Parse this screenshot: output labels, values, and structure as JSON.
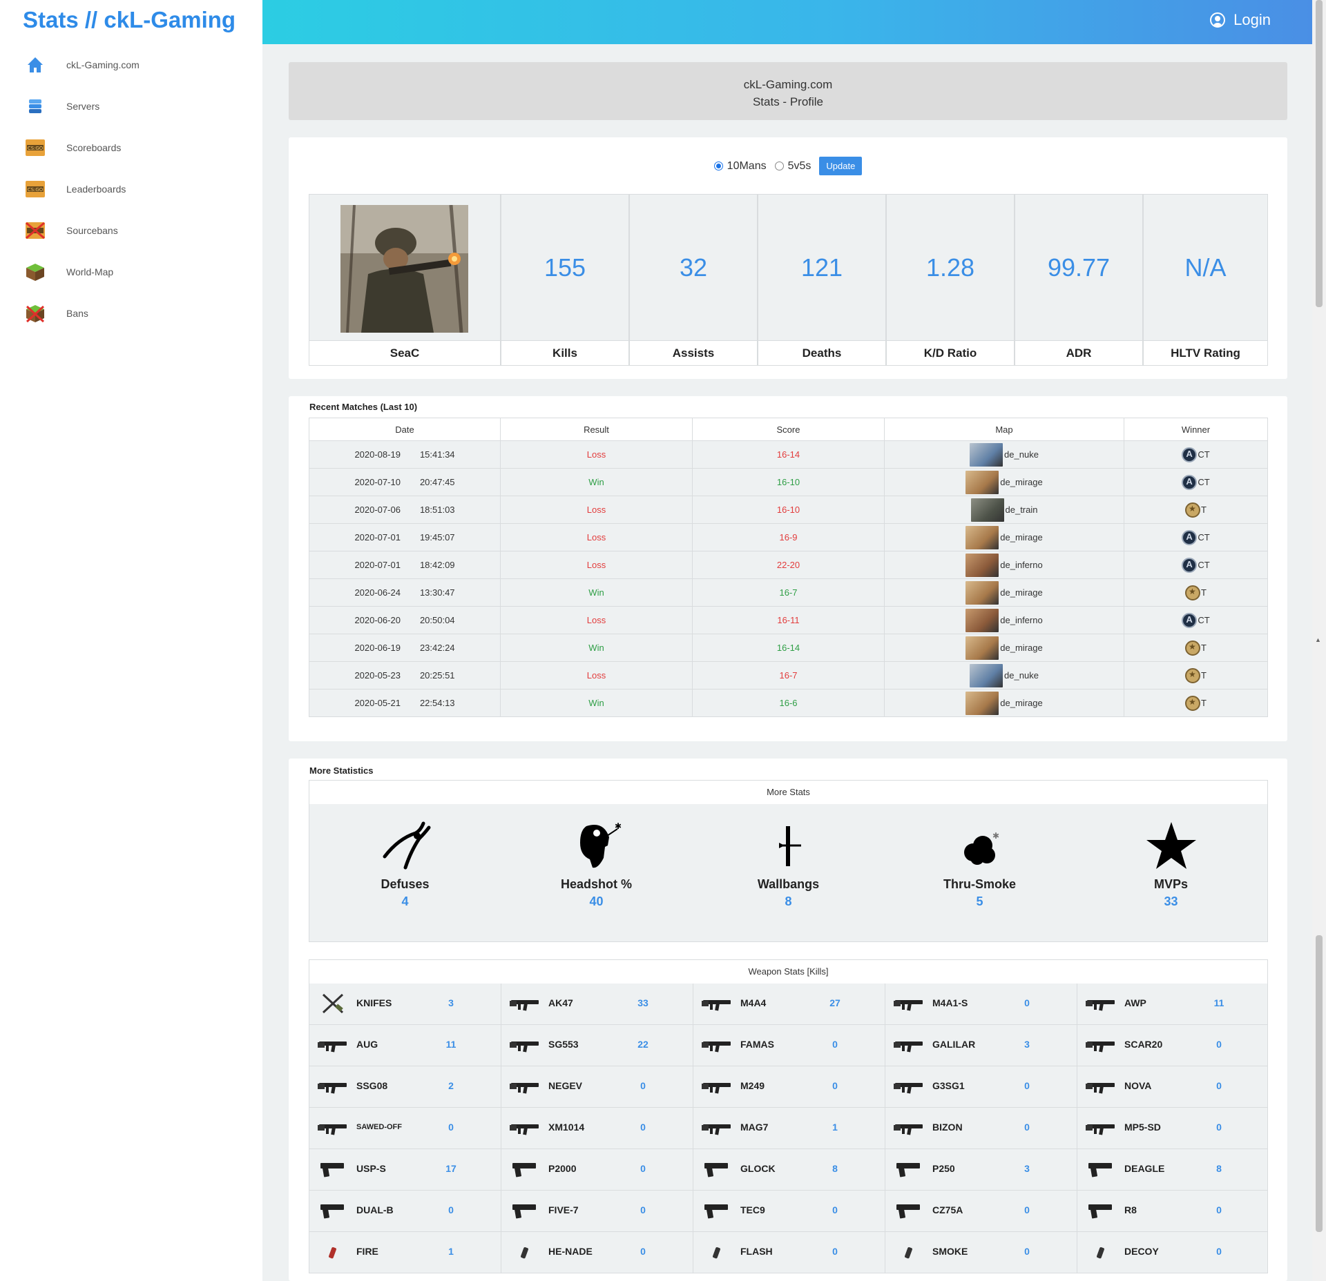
{
  "brand": "Stats // ckL-Gaming",
  "sidebar": {
    "items": [
      {
        "label": "ckL-Gaming.com",
        "icon": "home-icon"
      },
      {
        "label": "Servers",
        "icon": "server-icon"
      },
      {
        "label": "Scoreboards",
        "icon": "csgo-icon"
      },
      {
        "label": "Leaderboards",
        "icon": "csgo-icon"
      },
      {
        "label": "Sourcebans",
        "icon": "csgo-banned-icon"
      },
      {
        "label": "World-Map",
        "icon": "grass-block-icon"
      },
      {
        "label": "Bans",
        "icon": "grass-block-banned-icon"
      }
    ]
  },
  "topbar": {
    "login_label": "Login"
  },
  "header": {
    "line1": "ckL-Gaming.com",
    "line2": "Stats - Profile"
  },
  "mode": {
    "options": [
      "10Mans",
      "5v5s"
    ],
    "selected": "10Mans",
    "update_label": "Update"
  },
  "profile": {
    "player_name": "SeaC",
    "stats": [
      {
        "label": "Kills",
        "value": "155"
      },
      {
        "label": "Assists",
        "value": "32"
      },
      {
        "label": "Deaths",
        "value": "121"
      },
      {
        "label": "K/D Ratio",
        "value": "1.28"
      },
      {
        "label": "ADR",
        "value": "99.77"
      },
      {
        "label": "HLTV Rating",
        "value": "N/A"
      }
    ]
  },
  "matches": {
    "title": "Recent Matches (Last 10)",
    "columns": [
      "Date",
      "Result",
      "Score",
      "Map",
      "Winner"
    ],
    "rows": [
      {
        "date": "2020-08-19",
        "time": "15:41:34",
        "result": "Loss",
        "score": "16-14",
        "map": "de_nuke",
        "winner": "CT"
      },
      {
        "date": "2020-07-10",
        "time": "20:47:45",
        "result": "Win",
        "score": "16-10",
        "map": "de_mirage",
        "winner": "CT"
      },
      {
        "date": "2020-07-06",
        "time": "18:51:03",
        "result": "Loss",
        "score": "16-10",
        "map": "de_train",
        "winner": "T"
      },
      {
        "date": "2020-07-01",
        "time": "19:45:07",
        "result": "Loss",
        "score": "16-9",
        "map": "de_mirage",
        "winner": "CT"
      },
      {
        "date": "2020-07-01",
        "time": "18:42:09",
        "result": "Loss",
        "score": "22-20",
        "map": "de_inferno",
        "winner": "CT"
      },
      {
        "date": "2020-06-24",
        "time": "13:30:47",
        "result": "Win",
        "score": "16-7",
        "map": "de_mirage",
        "winner": "T"
      },
      {
        "date": "2020-06-20",
        "time": "20:50:04",
        "result": "Loss",
        "score": "16-11",
        "map": "de_inferno",
        "winner": "CT"
      },
      {
        "date": "2020-06-19",
        "time": "23:42:24",
        "result": "Win",
        "score": "16-14",
        "map": "de_mirage",
        "winner": "T"
      },
      {
        "date": "2020-05-23",
        "time": "20:25:51",
        "result": "Loss",
        "score": "16-7",
        "map": "de_nuke",
        "winner": "T"
      },
      {
        "date": "2020-05-21",
        "time": "22:54:13",
        "result": "Win",
        "score": "16-6",
        "map": "de_mirage",
        "winner": "T"
      }
    ]
  },
  "more": {
    "title": "More Statistics",
    "subtitle": "More Stats",
    "items": [
      {
        "label": "Defuses",
        "value": "4",
        "icon": "pliers-icon"
      },
      {
        "label": "Headshot %",
        "value": "40",
        "icon": "headshot-icon"
      },
      {
        "label": "Wallbangs",
        "value": "8",
        "icon": "wallbang-icon"
      },
      {
        "label": "Thru-Smoke",
        "value": "5",
        "icon": "smoke-icon"
      },
      {
        "label": "MVPs",
        "value": "33",
        "icon": "star-icon"
      }
    ]
  },
  "weapons": {
    "title": "Weapon Stats [Kills]",
    "rows": [
      [
        {
          "name": "KNIFES",
          "kills": "3"
        },
        {
          "name": "AK47",
          "kills": "33"
        },
        {
          "name": "M4A4",
          "kills": "27"
        },
        {
          "name": "M4A1-S",
          "kills": "0"
        },
        {
          "name": "AWP",
          "kills": "11"
        }
      ],
      [
        {
          "name": "AUG",
          "kills": "11"
        },
        {
          "name": "SG553",
          "kills": "22"
        },
        {
          "name": "FAMAS",
          "kills": "0"
        },
        {
          "name": "GALILAR",
          "kills": "3"
        },
        {
          "name": "SCAR20",
          "kills": "0"
        }
      ],
      [
        {
          "name": "SSG08",
          "kills": "2"
        },
        {
          "name": "NEGEV",
          "kills": "0"
        },
        {
          "name": "M249",
          "kills": "0"
        },
        {
          "name": "G3SG1",
          "kills": "0"
        },
        {
          "name": "NOVA",
          "kills": "0"
        }
      ],
      [
        {
          "name": "SAWED-OFF",
          "kills": "0"
        },
        {
          "name": "XM1014",
          "kills": "0"
        },
        {
          "name": "MAG7",
          "kills": "1"
        },
        {
          "name": "BIZON",
          "kills": "0"
        },
        {
          "name": "MP5-SD",
          "kills": "0"
        }
      ],
      [
        {
          "name": "USP-S",
          "kills": "17"
        },
        {
          "name": "P2000",
          "kills": "0"
        },
        {
          "name": "GLOCK",
          "kills": "8"
        },
        {
          "name": "P250",
          "kills": "3"
        },
        {
          "name": "DEAGLE",
          "kills": "8"
        }
      ],
      [
        {
          "name": "DUAL-B",
          "kills": "0"
        },
        {
          "name": "FIVE-7",
          "kills": "0"
        },
        {
          "name": "TEC9",
          "kills": "0"
        },
        {
          "name": "CZ75A",
          "kills": "0"
        },
        {
          "name": "R8",
          "kills": "0"
        }
      ],
      [
        {
          "name": "FIRE",
          "kills": "1"
        },
        {
          "name": "HE-NADE",
          "kills": "0"
        },
        {
          "name": "FLASH",
          "kills": "0"
        },
        {
          "name": "SMOKE",
          "kills": "0"
        },
        {
          "name": "DECOY",
          "kills": "0"
        }
      ]
    ]
  },
  "colors": {
    "accent": "#3a8ee6",
    "win": "#2e9e45",
    "loss": "#e23c3c",
    "brand": "#2e8be8"
  }
}
